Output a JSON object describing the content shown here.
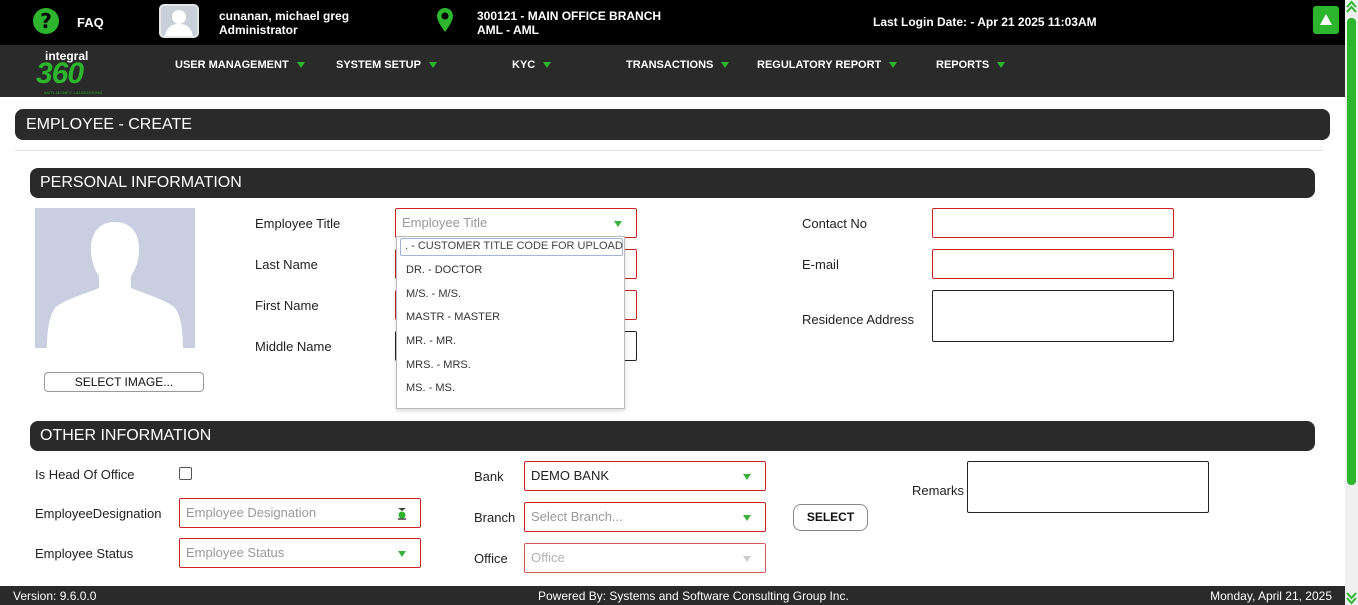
{
  "header": {
    "faq_label": "FAQ",
    "user_name": "cunanan, michael greg",
    "user_role": "Administrator",
    "branch": "300121 - MAIN OFFICE BRANCH",
    "module": "AML - AML",
    "last_login": "Last Login Date: - Apr 21 2025 11:03AM"
  },
  "logo": {
    "line1": "integral",
    "line2": "360",
    "line3": "ANTI-MONEY LAUNDERING"
  },
  "nav": {
    "items": [
      "USER MANAGEMENT",
      "SYSTEM SETUP",
      "KYC",
      "TRANSACTIONS",
      "REGULATORY REPORT",
      "REPORTS"
    ]
  },
  "page": {
    "title": "EMPLOYEE - CREATE"
  },
  "personal": {
    "section_title": "PERSONAL INFORMATION",
    "select_image_label": "SELECT IMAGE...",
    "employee_title_label": "Employee Title",
    "employee_title_placeholder": "Employee Title",
    "last_name_label": "Last Name",
    "first_name_label": "First Name",
    "middle_name_label": "Middle Name",
    "contact_label": "Contact No",
    "email_label": "E-mail",
    "address_label": "Residence Address",
    "title_options": [
      ". - CUSTOMER TITLE CODE FOR UPLOAD",
      "DR. - DOCTOR",
      "M/S. - M/S.",
      "MASTR - MASTER",
      "MR. - MR.",
      "MRS. - MRS.",
      "MS. - MS."
    ]
  },
  "other": {
    "section_title": "OTHER INFORMATION",
    "head_of_office_label": "Is Head Of Office",
    "designation_label": "EmployeeDesignation",
    "designation_placeholder": "Employee Designation",
    "status_label": "Employee Status",
    "status_placeholder": "Employee Status",
    "bank_label": "Bank",
    "bank_value": "DEMO BANK",
    "branch_label": "Branch",
    "branch_placeholder": "Select Branch...",
    "office_label": "Office",
    "office_placeholder": "Office",
    "select_button": "SELECT",
    "remarks_label": "Remarks"
  },
  "footer": {
    "version": "Version: 9.6.0.0",
    "powered_by": "Powered By: Systems and Software Consulting Group Inc.",
    "date": "Monday, April 21, 2025"
  },
  "colors": {
    "accent": "#2db52d",
    "bar": "#2a2a2a",
    "error_border": "#cc2222"
  }
}
